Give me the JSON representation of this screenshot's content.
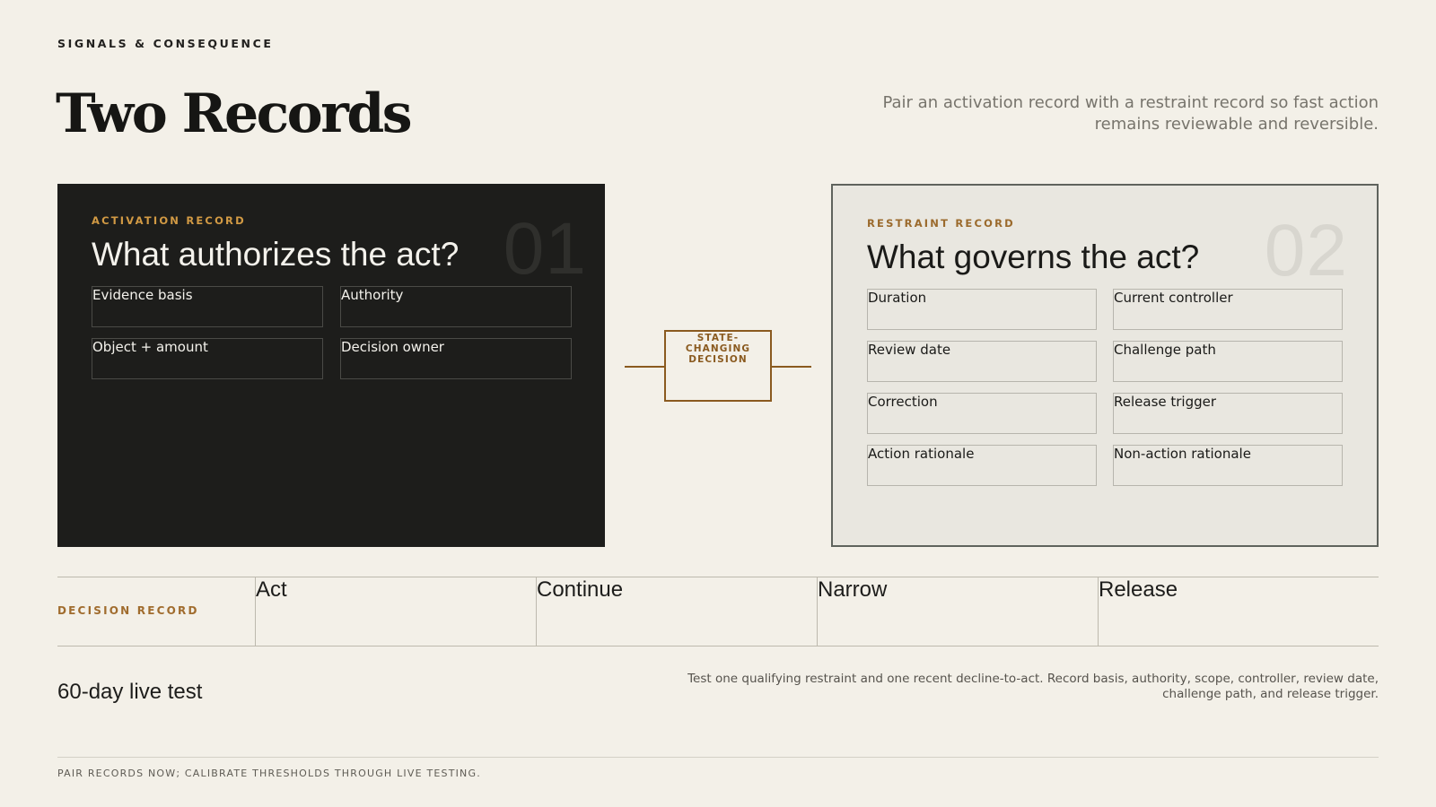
{
  "header": {
    "kicker": "SIGNALS & CONSEQUENCE",
    "title": "Two Records",
    "lede": "Pair an activation record with a restraint record so fast action remains reviewable and reversible."
  },
  "activation": {
    "label": "ACTIVATION RECORD",
    "number": "01",
    "question": "What authorizes the act?",
    "fields": [
      "Evidence basis",
      "Authority",
      "Object + amount",
      "Decision owner"
    ]
  },
  "connector": {
    "label": "STATE-CHANGING DECISION"
  },
  "restraint": {
    "label": "RESTRAINT RECORD",
    "number": "02",
    "question": "What governs the act?",
    "fields": [
      "Duration",
      "Current controller",
      "Review date",
      "Challenge path",
      "Correction",
      "Release trigger",
      "Action rationale",
      "Non-action rationale"
    ]
  },
  "decision": {
    "label": "DECISION RECORD",
    "options": [
      "Act",
      "Continue",
      "Narrow",
      "Release"
    ]
  },
  "test": {
    "label": "60-day live test",
    "body": "Test one qualifying restraint and one recent decline-to-act. Record basis, authority, scope, controller, review date, challenge path, and release trigger."
  },
  "footer": {
    "note": "PAIR RECORDS NOW; CALIBRATE THRESHOLDS THROUGH LIVE TESTING."
  },
  "colors": {
    "background": "#f3f0e8",
    "dark_card": "#1d1d1b",
    "light_card": "#e9e7e0",
    "accent": "#8a5a1f",
    "label_gold": "#d29a44"
  }
}
